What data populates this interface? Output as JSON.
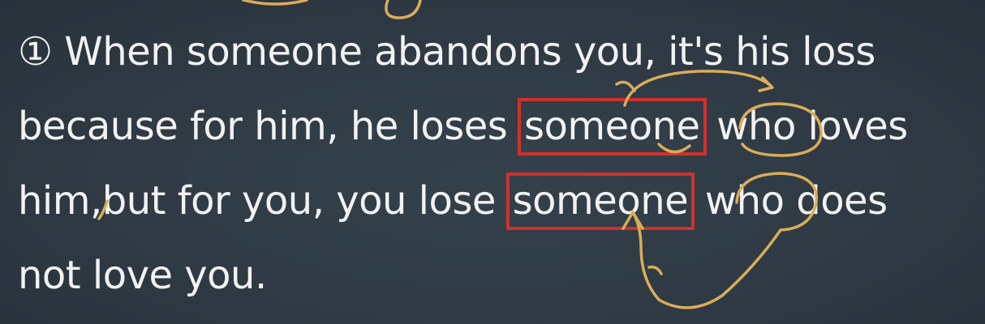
{
  "sentence": {
    "line1": "① When someone abandons you, it's his loss",
    "line2_before": "because for him, he loses ",
    "line2_box": "someone",
    "line2_after": " who loves",
    "line3_before": "him,but for you, you lose ",
    "line3_box": "someone",
    "line3_after": " who does",
    "line4": "not love you."
  },
  "colors": {
    "background": "#2f3a44",
    "text": "#f2f2f2",
    "highlight_box": "#d0312d",
    "pen_annotation": "#d9ad5a"
  }
}
